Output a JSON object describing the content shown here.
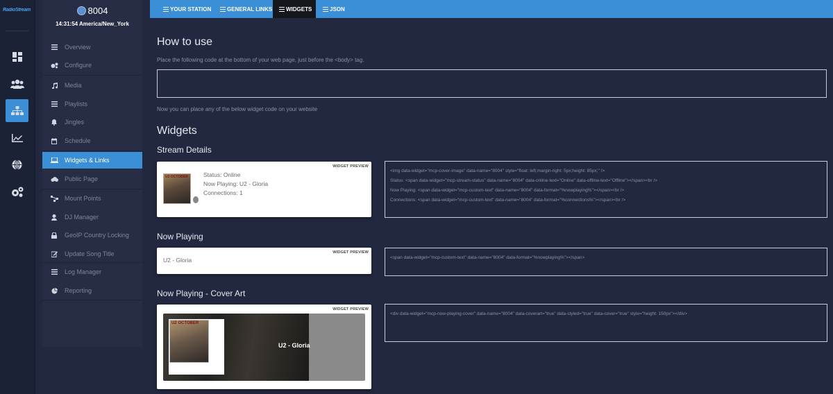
{
  "brand": {
    "logo_text": "RadioStream"
  },
  "rail": {
    "items": [
      "dashboard-icon",
      "users-icon",
      "sitemap-icon",
      "chart-icon",
      "globe-icon",
      "cogs-icon"
    ],
    "active_index": 2
  },
  "sidebar": {
    "station_name": "8004",
    "clock": "14:31:54 America/New_York",
    "items": [
      {
        "label": "Overview",
        "icon": "bars-icon"
      },
      {
        "label": "Configure",
        "icon": "cogs-icon"
      },
      {
        "label": "Media",
        "icon": "music-icon"
      },
      {
        "label": "Playlists",
        "icon": "list-icon"
      },
      {
        "label": "Jingles",
        "icon": "bell-icon"
      },
      {
        "label": "Schedule",
        "icon": "calendar-icon"
      },
      {
        "label": "Widgets & Links",
        "icon": "laptop-icon",
        "active": true
      },
      {
        "label": "Public Page",
        "icon": "cloud-icon"
      },
      {
        "label": "Mount Points",
        "icon": "sitemap-icon"
      },
      {
        "label": "DJ Manager",
        "icon": "user-icon"
      },
      {
        "label": "GeoIP Country Locking",
        "icon": "lock-icon"
      },
      {
        "label": "Update Song Title",
        "icon": "edit-icon"
      },
      {
        "label": "Log Manager",
        "icon": "list-icon"
      },
      {
        "label": "Reporting",
        "icon": "pie-chart-icon"
      }
    ]
  },
  "tabs": [
    {
      "label": "YOUR STATION"
    },
    {
      "label": "GENERAL LINKS"
    },
    {
      "label": "WIDGETS",
      "active": true
    },
    {
      "label": "JSON"
    }
  ],
  "main": {
    "how_title": "How to use",
    "how_text": "Place the following code at the bottom of your web page, just before the <body> tag.",
    "how_code": "",
    "after_text": "Now you can place any of the below widget code on your website",
    "widgets_title": "Widgets",
    "preview_tag": "WIDGET PREVIEW",
    "sections": [
      {
        "title": "Stream Details",
        "status": "Status: Online",
        "now_playing": "Now Playing: U2 - Gloria",
        "connections": "Connections: 1",
        "code": [
          "<img data-widget=\"mcp-cover-image\" data-name=\"8004\" style=\"float: left;margin-right: 5px;height: 85px;\" />",
          "Status: <span data-widget=\"mcp-stream-status\" data-name=\"8004\" data-online-text=\"Online\" data-offline-text=\"Offline\"></span><br />",
          "Now Playing: <span data-widget=\"mcp-custom-text\" data-name=\"8004\" data-format=\"%nowplaying%\"></span><br />",
          "Connections: <span data-widget=\"mcp-custom-text\" data-name=\"8004\" data-format=\"%connections%\"></span><br />"
        ]
      },
      {
        "title": "Now Playing",
        "text": "U2 - Gloria",
        "code": [
          "<span data-widget=\"mcp-custom-text\" data-name=\"8004\" data-format=\"%nowplaying%\"></span>"
        ]
      },
      {
        "title": "Now Playing - Cover Art",
        "text": "U2 - Gloria",
        "album_text": "U2 OCTOBER",
        "code": [
          "<div data-widget=\"mcp-now-playing-cover\" data-name=\"8004\" data-coverart=\"true\" data-styled=\"true\" data-cover=\"true\" style=\"height: 150px\"></div>"
        ]
      }
    ]
  },
  "colors": {
    "accent": "#3a8fd6",
    "background": "#222840",
    "sidebar": "#272d44",
    "active_tab": "#15171d"
  }
}
